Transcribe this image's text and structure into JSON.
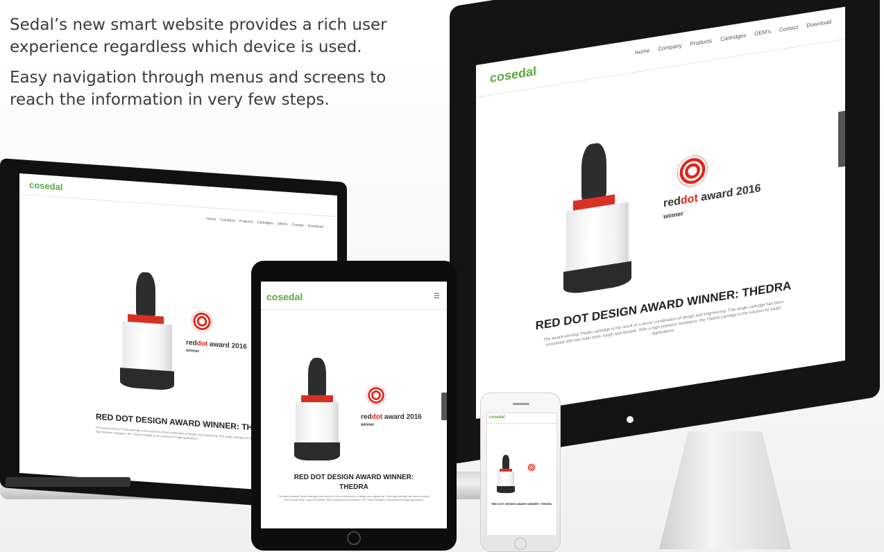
{
  "intro": {
    "line1": "Sedal’s new smart website provides a rich user experience regardless which device is used.",
    "line2": "Easy navigation through menus and screens to reach the information in very few steps."
  },
  "site": {
    "logo": "cosedal",
    "nav": [
      "Home",
      "Company",
      "Products",
      "Cartridges",
      "OEM's",
      "Contact",
      "Download"
    ],
    "award_prefix": "red",
    "award_dot": "dot",
    "award_suffix": " award 2016",
    "award_winner": "winner",
    "headline": "RED DOT DESIGN AWARD WINNER: THEDRA",
    "body": "The award-winning Thedra cartridge is the result of a clever combination of design and engineering. This single cartridge has been conceived with two main aims: tough and durable. With a high pressure resistance, the Thedra cartridge is the solution for tough applications."
  },
  "colors": {
    "brand_green": "#5aa83f",
    "accent_red": "#e1251b"
  }
}
